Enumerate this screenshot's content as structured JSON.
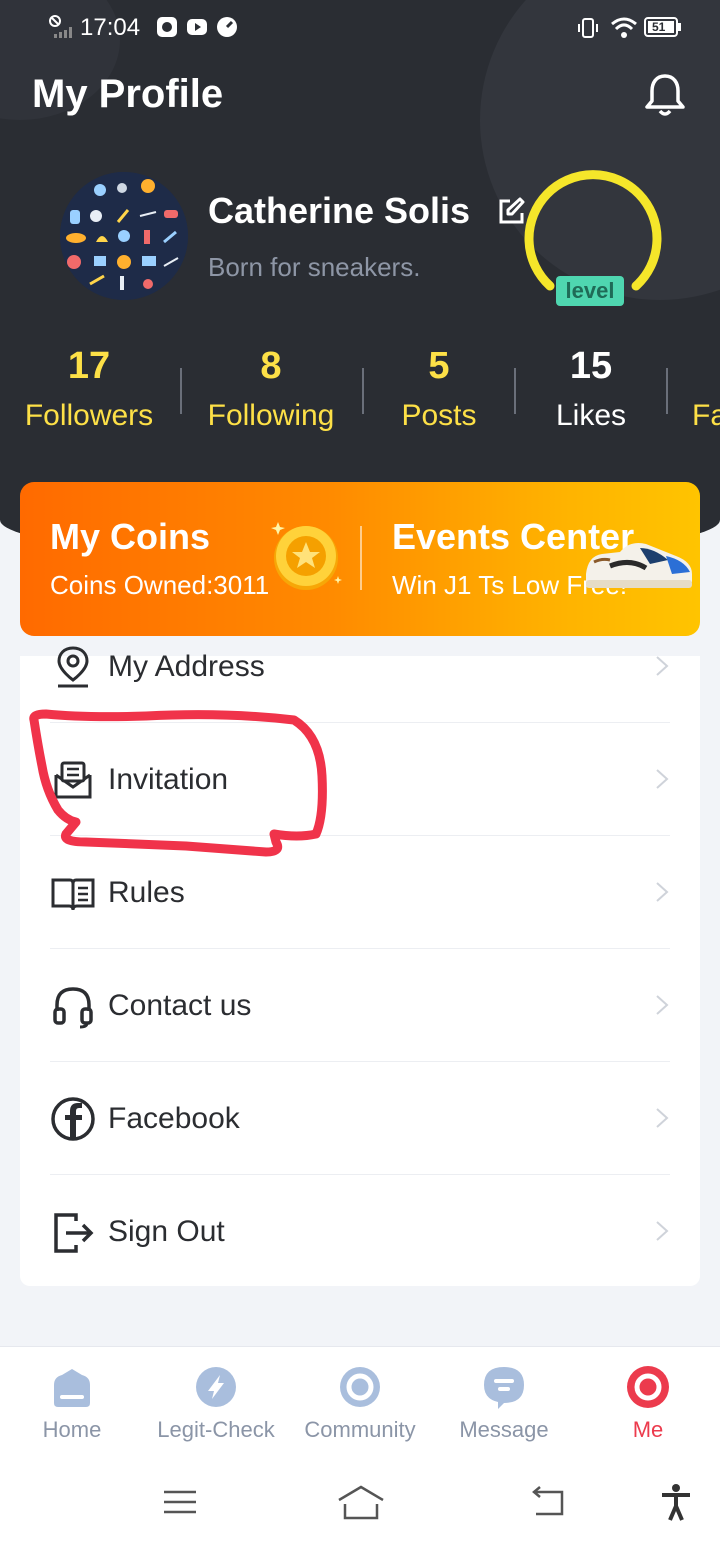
{
  "status_bar": {
    "time": "17:04",
    "battery": "51"
  },
  "header": {
    "title": "My Profile"
  },
  "profile": {
    "name": "Catherine Solis",
    "bio": "Born for sneakers.",
    "level_label": "level"
  },
  "stats": [
    {
      "value": "17",
      "label": "Followers"
    },
    {
      "value": "8",
      "label": "Following"
    },
    {
      "value": "5",
      "label": "Posts"
    },
    {
      "value": "15",
      "label": "Likes"
    },
    {
      "value": "",
      "label": "Fa"
    }
  ],
  "coins": {
    "title": "My Coins",
    "subtitle": "Coins Owned:3011"
  },
  "events": {
    "title": "Events Center",
    "subtitle": "Win J1 Ts Low Free!"
  },
  "menu": [
    {
      "label": "My Address",
      "icon": "location-pin-icon"
    },
    {
      "label": "Invitation",
      "icon": "envelope-icon"
    },
    {
      "label": "Rules",
      "icon": "book-icon"
    },
    {
      "label": "Contact us",
      "icon": "headset-icon"
    },
    {
      "label": "Facebook",
      "icon": "facebook-icon"
    },
    {
      "label": "Sign Out",
      "icon": "sign-out-icon"
    }
  ],
  "tabs": [
    {
      "label": "Home",
      "icon": "home-icon"
    },
    {
      "label": "Legit-Check",
      "icon": "legit-check-icon"
    },
    {
      "label": "Community",
      "icon": "community-icon"
    },
    {
      "label": "Message",
      "icon": "message-icon"
    },
    {
      "label": "Me",
      "icon": "me-icon",
      "active": true
    }
  ],
  "colors": {
    "accent_yellow": "#fde047",
    "active_tab": "#ec3b4d",
    "header_bg": "#2a2d33",
    "annotation_red": "#f0334a"
  }
}
